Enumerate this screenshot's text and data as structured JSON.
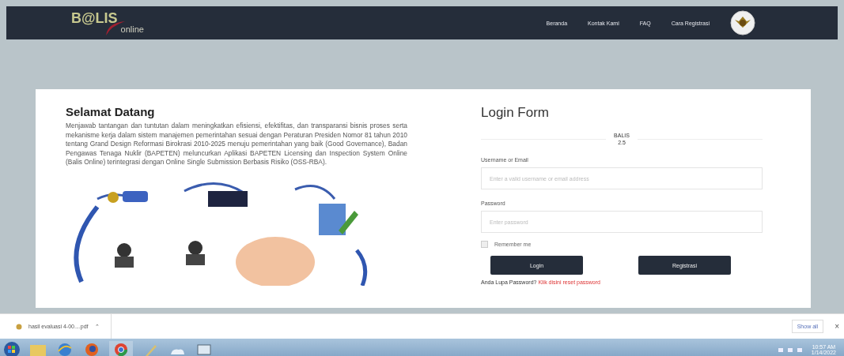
{
  "nav": {
    "logo": "B@LIS",
    "logo_sub": "online",
    "links": [
      {
        "label": "Beranda"
      },
      {
        "label": "Kontak Kami"
      },
      {
        "label": "FAQ"
      },
      {
        "label": "Cara Registrasi"
      }
    ]
  },
  "welcome": {
    "title": "Selamat Datang",
    "paragraph": "Menjawab tantangan dan tuntutan dalam meningkatkan efisiensi, efektifitas, dan transparansi bisnis proses serta mekanisme kerja dalam sistem manajemen pemerintahan sesuai dengan Peraturan Presiden Nomor 81 tahun 2010 tentang Grand Design Reformasi Birokrasi 2010-2025 menuju pemerintahan yang baik (Good Governance), Badan Pengawas Tenaga Nuklir (BAPETEN) meluncurkan Aplikasi BAPETEN Licensing dan Inspection System Online (Balis Online) terintegrasi dengan Online Single Submission Berbasis Risiko (OSS-RBA).",
    "diagram": {
      "kind": "picture"
    }
  },
  "login": {
    "title": "Login Form",
    "version_name": "BALIS",
    "version": "2.5",
    "username": {
      "label": "Username or Email",
      "placeholder": "Enter a valid username or email address"
    },
    "password": {
      "label": "Password",
      "placeholder": "Enter password"
    },
    "remember": {
      "label": "Remember me",
      "checked": false
    },
    "buttons": [
      {
        "label": "Login"
      },
      {
        "label": "Registrasi"
      }
    ],
    "forgot": {
      "text": "Anda Lupa Password?",
      "link": "Klik disini reset password"
    }
  },
  "download_bar": {
    "file": "hasil evaluasi 4-00....pdf",
    "caret": "⌃",
    "show_all": "Show all",
    "close": "×"
  },
  "taskbar": {
    "time": "10:57 AM",
    "date": "1/14/2022"
  }
}
